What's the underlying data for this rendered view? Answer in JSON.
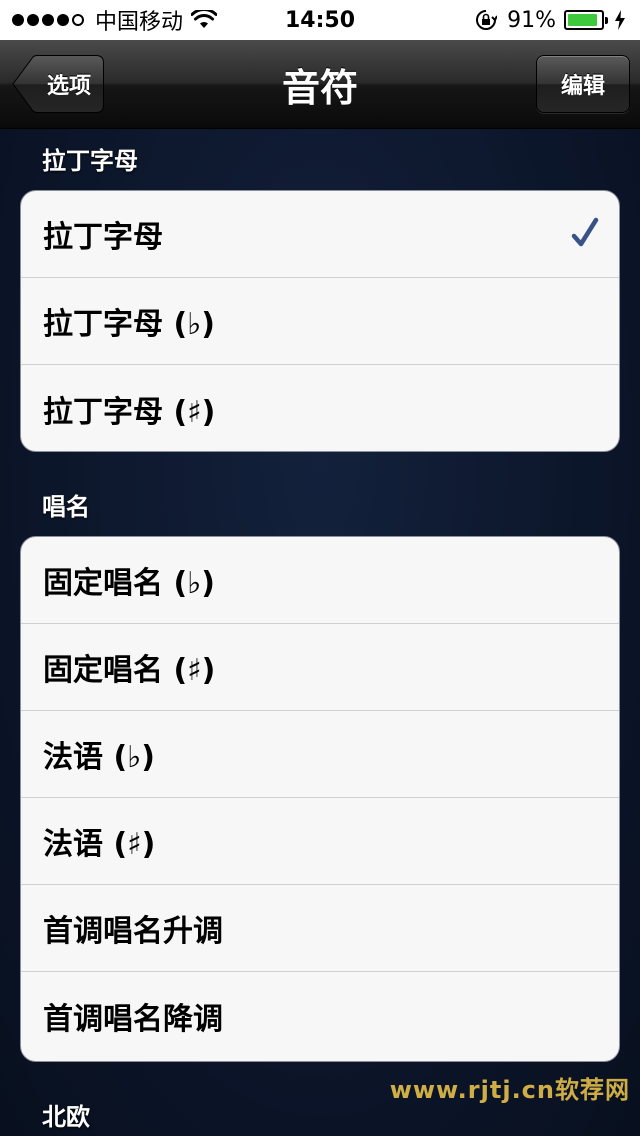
{
  "status_bar": {
    "carrier": "中国移动",
    "time": "14:50",
    "battery_percent": "91%",
    "battery_level": 0.91,
    "signal_bars_filled": 4,
    "signal_bars_total": 5
  },
  "nav": {
    "title": "音符",
    "back_label": "选项",
    "edit_label": "编辑"
  },
  "sections": [
    {
      "header": "拉丁字母",
      "items": [
        {
          "label": "拉丁字母",
          "checked": true
        },
        {
          "label": "拉丁字母 (♭)",
          "checked": false
        },
        {
          "label": "拉丁字母 (♯)",
          "checked": false
        }
      ]
    },
    {
      "header": "唱名",
      "items": [
        {
          "label": "固定唱名 (♭)",
          "checked": false
        },
        {
          "label": "固定唱名 (♯)",
          "checked": false
        },
        {
          "label": "法语 (♭)",
          "checked": false
        },
        {
          "label": "法语 (♯)",
          "checked": false
        },
        {
          "label": "首调唱名升调",
          "checked": false
        },
        {
          "label": "首调唱名降调",
          "checked": false
        }
      ]
    },
    {
      "header": "北欧",
      "items": []
    }
  ],
  "watermark": "www.rjtj.cn软荐网",
  "colors": {
    "checkmark": "#385487",
    "battery": "#3ec83b"
  }
}
